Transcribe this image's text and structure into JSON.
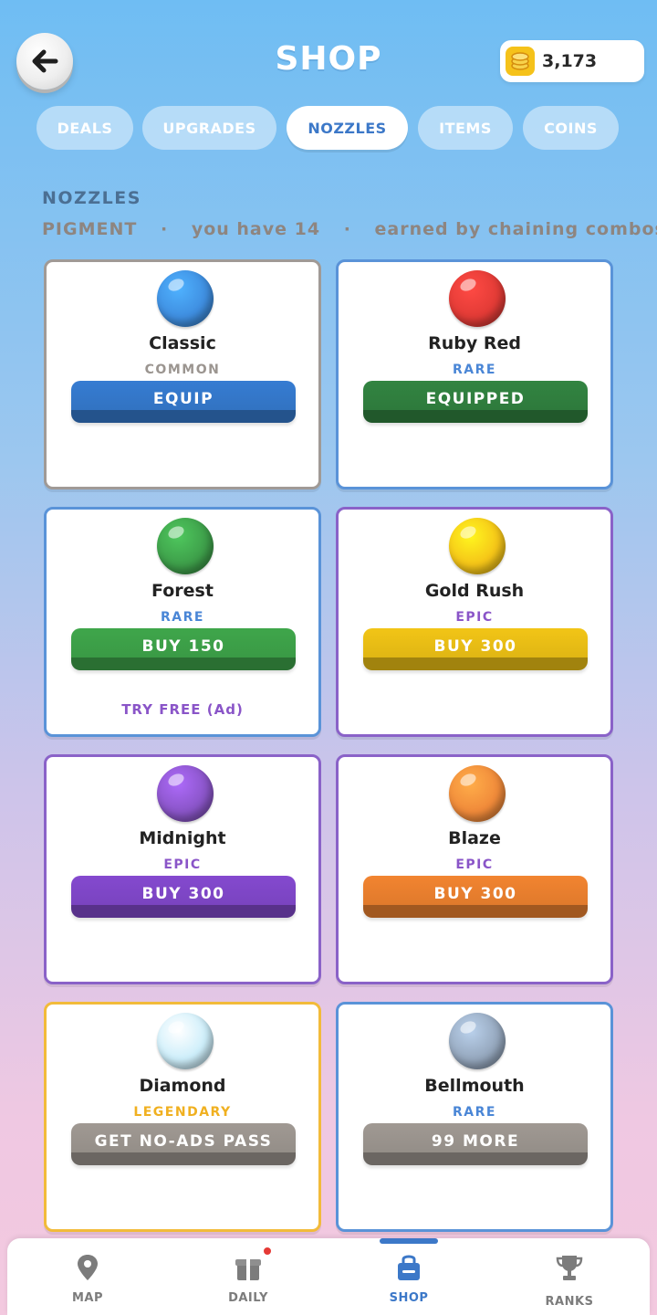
{
  "header": {
    "title": "SHOP",
    "coins": "3,173",
    "back_icon": "arrow-left-icon",
    "coin_icon": "coin-stack-icon"
  },
  "tabs": [
    {
      "label": "DEALS",
      "active": false
    },
    {
      "label": "UPGRADES",
      "active": false
    },
    {
      "label": "NOZZLES",
      "active": true
    },
    {
      "label": "ITEMS",
      "active": false
    },
    {
      "label": "COINS",
      "active": false
    }
  ],
  "section": {
    "title": "NOZZLES",
    "pigment_label": "PIGMENT",
    "separator": "·",
    "pigment_count": "you have 14",
    "pigment_hint": "earned by chaining combos"
  },
  "nozzles": [
    {
      "name": "Classic",
      "rarity": "COMMON",
      "action": "EQUIP",
      "sub_action": "",
      "orb_color": "#3f8ee0",
      "rarity_color": "#9b9590",
      "border_color": "#a09a96",
      "button_color": "#3273c2"
    },
    {
      "name": "Ruby Red",
      "rarity": "RARE",
      "action": "EQUIPPED",
      "sub_action": "",
      "orb_color": "#e23b36",
      "rarity_color": "#4a86d6",
      "border_color": "#5a93d8",
      "button_color": "#2e7a3c"
    },
    {
      "name": "Forest",
      "rarity": "RARE",
      "action": "BUY  150",
      "sub_action": "TRY FREE (Ad)",
      "orb_color": "#3e9f4a",
      "rarity_color": "#4a86d6",
      "border_color": "#5a93d8",
      "button_color": "#3a9a45"
    },
    {
      "name": "Gold Rush",
      "rarity": "EPIC",
      "action": "BUY  300",
      "sub_action": "",
      "orb_color": "#f5c518",
      "rarity_color": "#8a55c8",
      "border_color": "#8a62c8",
      "button_color": "#e0b614"
    },
    {
      "name": "Midnight",
      "rarity": "EPIC",
      "action": "BUY  300",
      "sub_action": "",
      "orb_color": "#8a55c8",
      "rarity_color": "#8a55c8",
      "border_color": "#8a62c8",
      "button_color": "#7a44c0"
    },
    {
      "name": "Blaze",
      "rarity": "EPIC",
      "action": "BUY  300",
      "sub_action": "",
      "orb_color": "#f08a3a",
      "rarity_color": "#8a55c8",
      "border_color": "#8a62c8",
      "button_color": "#e07a2c"
    },
    {
      "name": "Diamond",
      "rarity": "LEGENDARY",
      "action": "GET NO-ADS PASS",
      "sub_action": "",
      "orb_color": "#cdeefa",
      "rarity_color": "#f0b020",
      "border_color": "#f2bb3a",
      "button_color": "#948e88"
    },
    {
      "name": "Bellmouth",
      "rarity": "RARE",
      "action": "99 MORE",
      "sub_action": "",
      "orb_color": "#95a7bd",
      "rarity_color": "#4a86d6",
      "border_color": "#5a93d8",
      "button_color": "#948e88"
    }
  ],
  "nav": [
    {
      "label": "MAP",
      "icon": "map-pin-icon",
      "active": false
    },
    {
      "label": "DAILY",
      "icon": "gift-icon",
      "active": false,
      "badge": true
    },
    {
      "label": "SHOP",
      "icon": "shop-bag-icon",
      "active": true
    },
    {
      "label": "RANKS",
      "icon": "trophy-icon",
      "active": false
    }
  ],
  "colors": {
    "accent": "#3c78c8",
    "badge": "#e53935"
  }
}
